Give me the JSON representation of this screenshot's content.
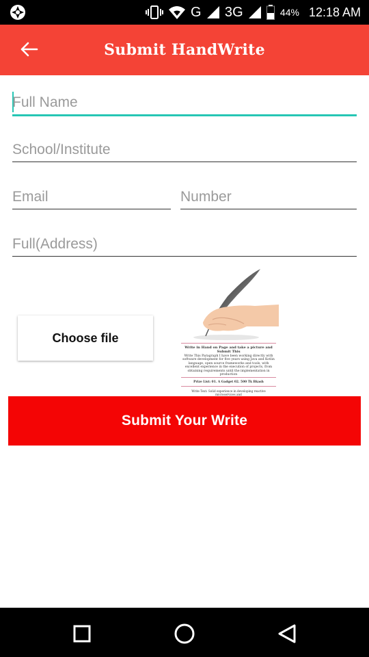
{
  "status_bar": {
    "network_g": "G",
    "network_3g": "3G",
    "battery_percent": "44%",
    "time": "12:18 AM"
  },
  "app_bar": {
    "title": "Submit HandWrite"
  },
  "form": {
    "full_name_placeholder": "Full Name",
    "school_placeholder": "School/Institute",
    "email_placeholder": "Email",
    "number_placeholder": "Number",
    "address_placeholder": "Full(Address)",
    "choose_file_label": "Choose file",
    "submit_label": "Submit Your Write"
  },
  "preview": {
    "doc_title": "Write in Hand on Page and take a picture and Submit This",
    "doc_body": "Write This Paragraph I have been working directly with software development for five years using Java and Kotlin language, open source frameworks and tools, with excellent experience in the execution of projects, from obtaining requirements until the implementation in production",
    "doc_prize": "Prize List: 01. A Gadget 02. 500 Tk Bkash",
    "doc_write": "Write Text: Solid experience in developing reactive microservices and"
  },
  "colors": {
    "app_bar": "#f44336",
    "submit": "#f40505",
    "focus_accent": "#26c6b4"
  },
  "icons": {
    "back": "arrow-left-icon",
    "recents": "square-icon",
    "home": "circle-icon",
    "nav_back": "triangle-back-icon"
  }
}
